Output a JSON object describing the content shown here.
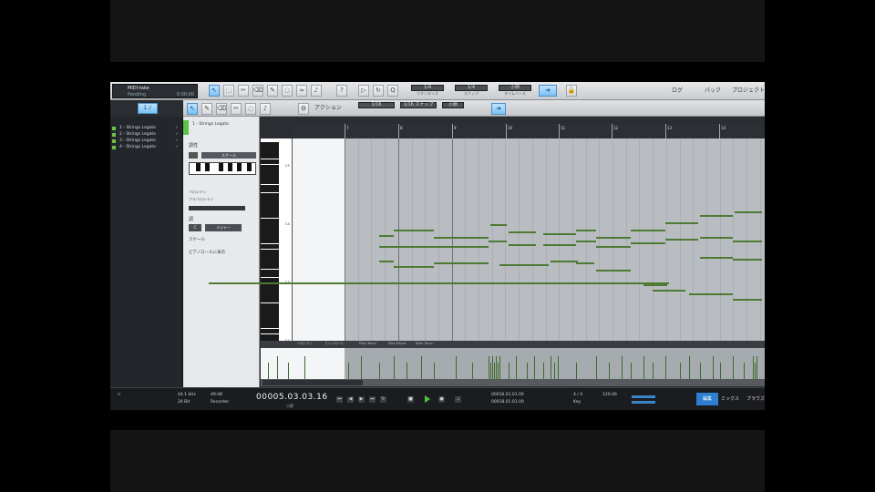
{
  "song": {
    "title": "MIDI-take",
    "subtitle": "Pending",
    "meta": "0:00:00"
  },
  "toolbar": {
    "lcds": [
      {
        "value": "1/4",
        "caption": "クオンタイズ"
      },
      {
        "value": "1/4",
        "caption": "スナップ"
      },
      {
        "value": "小節",
        "caption": "タイムベース"
      }
    ],
    "right_buttons": [
      "ログ",
      "パック",
      "プロジェクト"
    ]
  },
  "toolbar2": {
    "left_button": "1 ♪",
    "dropdown_label": "アクション",
    "lcds": [
      "1/16",
      "1/16 スナップ",
      "小節"
    ]
  },
  "tracks": [
    {
      "name": "1 - Strings Legato"
    },
    {
      "name": "2 - Strings Legato"
    },
    {
      "name": "3 - Strings Legato"
    },
    {
      "name": "4 - Strings Legato"
    }
  ],
  "inspector": {
    "name": "1 - Strings Legato",
    "section1": "調性",
    "select_value": "スケール",
    "section2": "ベロシティ",
    "section2b": "フルベロシティ",
    "section3": "調",
    "btn_a": "C",
    "btn_b": "メジャー",
    "check1": "スケール",
    "check2": "ピアノロールに表示"
  },
  "pianoroll": {
    "bars": [
      "7",
      "8",
      "9",
      "10",
      "11",
      "12",
      "13",
      "14"
    ],
    "key_labels": [
      "C5",
      "C4",
      "C3",
      "C2"
    ]
  },
  "lanes": {
    "tabs": [
      "ベロシティ",
      "コントロール",
      "Pitch Bend",
      "Mod Wheel",
      "After Touch"
    ]
  },
  "transport": {
    "sample_rate": "44.1 kHz",
    "bits": "24 Bit",
    "time_label": "49:48",
    "mode": "Recorder",
    "position": "00005.03.03.16",
    "position_sub": "小節",
    "loop_start": "00016.01.01.00",
    "loop_end": "00018.01.01.00",
    "tempo": "120.00",
    "timesig": "4 / 4",
    "key": "Key",
    "edit": "編集",
    "mix": "ミックス",
    "browse": "ブラウズ"
  },
  "colors": {
    "note": "#4f7a33",
    "accent": "#2f7fd0",
    "track_dot": "#6cc24a"
  }
}
